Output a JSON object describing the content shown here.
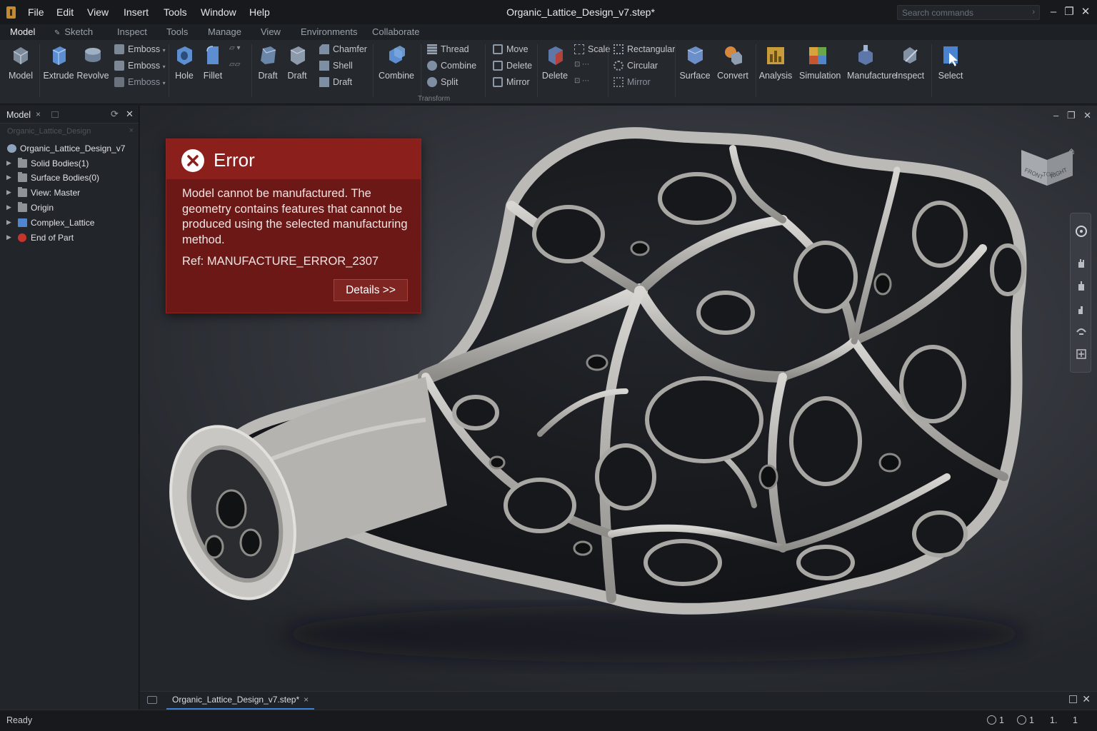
{
  "app": {
    "title": "Organic_Lattice_Design_v7.step*",
    "menu": [
      "File",
      "Edit",
      "View",
      "Insert",
      "Tools",
      "Window",
      "Help"
    ],
    "search": {
      "placeholder": "Search commands"
    }
  },
  "ribbon": {
    "tabs": [
      "Model",
      "Sketch",
      "Inspect",
      "Tools",
      "Manage",
      "View",
      "Environments",
      "Collaborate"
    ],
    "active_tab": "Model",
    "buttons": {
      "model": "Model",
      "extrude": "Extrude",
      "revolve": "Revolve",
      "emboss1": "Emboss",
      "emboss2": "Emboss",
      "emboss3": "Emboss",
      "hole": "Hole",
      "fillet": "Fillet",
      "draft1": "Draft",
      "draft2": "Draft",
      "chamfer": "Chamfer",
      "shell": "Shell",
      "draft3": "Draft",
      "combine": "Combine",
      "thread": "Thread",
      "combine_small": "Combine",
      "split": "Split",
      "move": "Move",
      "delete": "Delete",
      "mirror": "Mirror",
      "delete_big": "Delete",
      "scale": "Scale",
      "rectangular": "Rectangular",
      "circular": "Circular",
      "mirror_pattern": "Mirror",
      "surface": "Surface",
      "convert": "Convert",
      "analysis": "Analysis",
      "simulation": "Simulation",
      "manufacture": "Manufacture",
      "inspect": "Inspect",
      "select": "Select"
    },
    "group_label": "Transform"
  },
  "browser": {
    "title": "Model",
    "filter": "Organic_Lattice_Design",
    "items": [
      {
        "label": "Organic_Lattice_Design_v7",
        "type": "root"
      },
      {
        "label": "Solid Bodies(1)",
        "type": "folder"
      },
      {
        "label": "Surface Bodies(0)",
        "type": "folder"
      },
      {
        "label": "View: Master",
        "type": "folder"
      },
      {
        "label": "Origin",
        "type": "folder"
      },
      {
        "label": "Complex_Lattice",
        "type": "feature"
      },
      {
        "label": "End of Part",
        "type": "end"
      }
    ]
  },
  "error": {
    "title": "Error",
    "message": "Model cannot be manufactured. The geometry contains features that cannot be produced using the selected manufacturing method.",
    "ref": "Ref: MANUFACTURE_ERROR_2307",
    "details_label": "Details >>"
  },
  "viewcube": {
    "top": "TOP",
    "front": "FRONT",
    "right": "RIGHT"
  },
  "document_tab": "Organic_Lattice_Design_v7.step*",
  "status": {
    "text": "Ready",
    "counters": [
      "1",
      "1",
      "1.",
      "1"
    ]
  },
  "colors": {
    "error_header": "#8b1f1b",
    "error_body": "#6b1816",
    "accent": "#3b82d6",
    "viewport_bg": "#35383e"
  }
}
